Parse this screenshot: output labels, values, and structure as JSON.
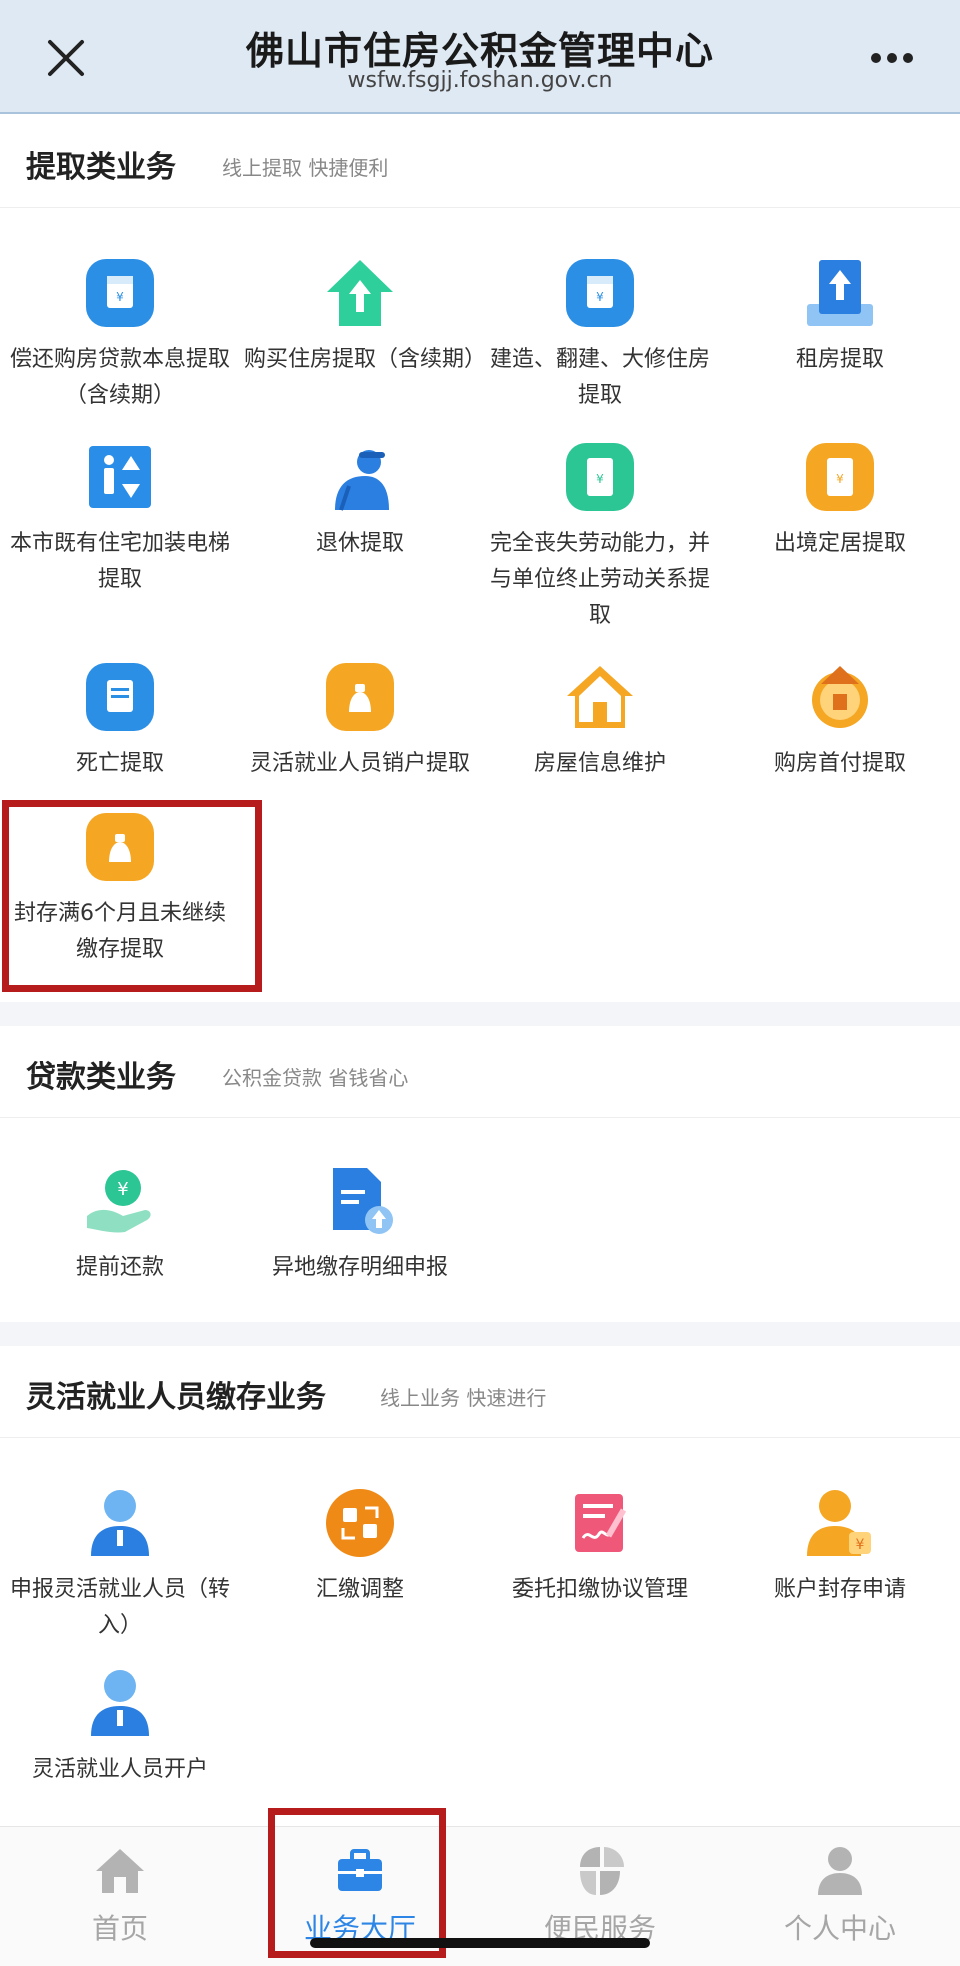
{
  "header": {
    "title": "佛山市住房公积金管理中心",
    "url": "wsfw.fsgjj.foshan.gov.cn"
  },
  "sections": {
    "withdraw": {
      "title": "提取类业务",
      "subtitle": "线上提取 快捷便利",
      "items": [
        {
          "label": "偿还购房贷款本息提取（含续期）"
        },
        {
          "label": "购买住房提取（含续期）"
        },
        {
          "label": "建造、翻建、大修住房提取"
        },
        {
          "label": "租房提取"
        },
        {
          "label": "本市既有住宅加装电梯提取"
        },
        {
          "label": "退休提取"
        },
        {
          "label": "完全丧失劳动能力，并与单位终止劳动关系提取"
        },
        {
          "label": "出境定居提取"
        },
        {
          "label": "死亡提取"
        },
        {
          "label": "灵活就业人员销户提取"
        },
        {
          "label": "房屋信息维护"
        },
        {
          "label": "购房首付提取"
        },
        {
          "label": "封存满6个月且未继续缴存提取"
        }
      ]
    },
    "loan": {
      "title": "贷款类业务",
      "subtitle": "公积金贷款 省钱省心",
      "items": [
        {
          "label": "提前还款"
        },
        {
          "label": "异地缴存明细申报"
        }
      ]
    },
    "flexible": {
      "title": "灵活就业人员缴存业务",
      "subtitle": "线上业务 快速进行",
      "items": [
        {
          "label": "申报灵活就业人员（转入）"
        },
        {
          "label": "汇缴调整"
        },
        {
          "label": "委托扣缴协议管理"
        },
        {
          "label": "账户封存申请"
        },
        {
          "label": "灵活就业人员开户"
        }
      ]
    }
  },
  "tabbar": {
    "items": [
      {
        "label": "首页",
        "active": false
      },
      {
        "label": "业务大厅",
        "active": true
      },
      {
        "label": "便民服务",
        "active": false
      },
      {
        "label": "个人中心",
        "active": false
      }
    ]
  },
  "colors": {
    "accent": "#2d86e6",
    "highlight": "#b71c1c",
    "header_bg": "#dfe9f3"
  }
}
